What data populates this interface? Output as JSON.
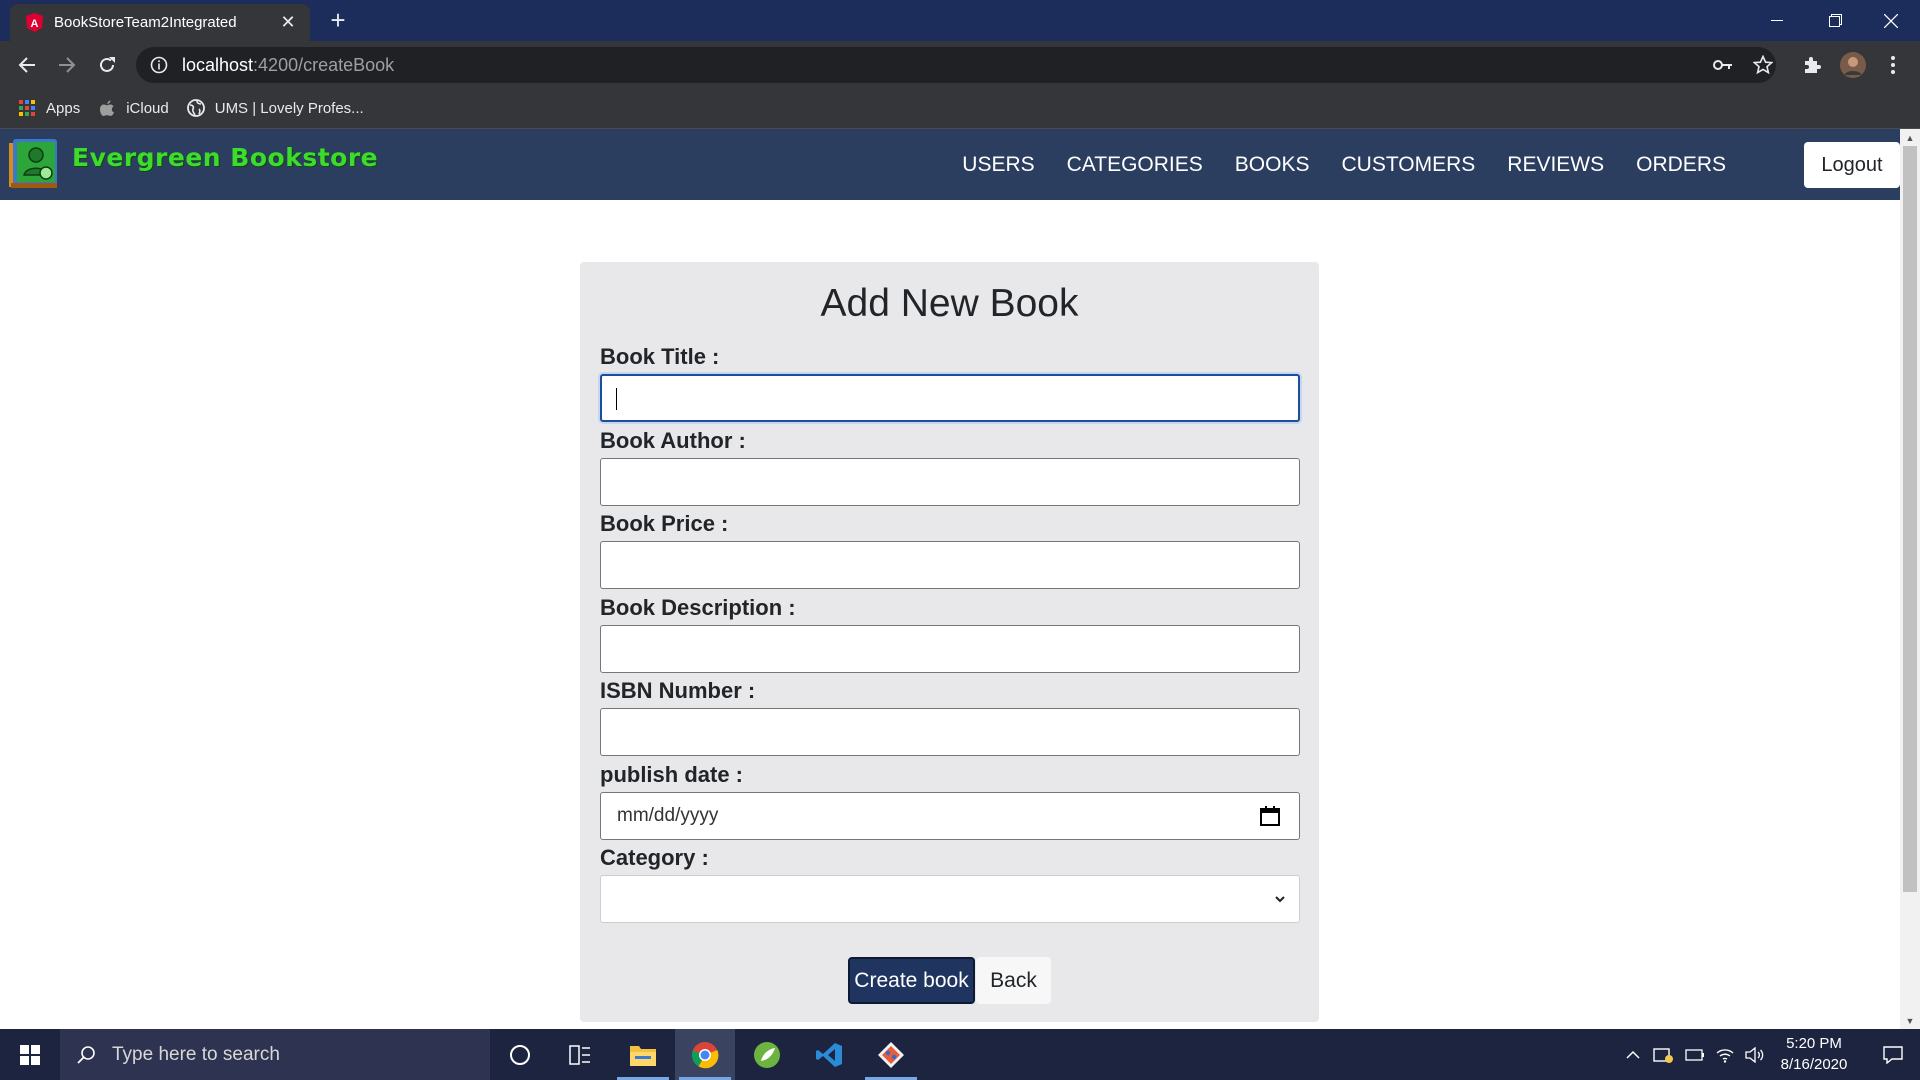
{
  "browser": {
    "tab_title": "BookStoreTeam2Integrated",
    "url_host": "localhost",
    "url_path": ":4200/createBook",
    "bookmarks": [
      {
        "label": "Apps",
        "icon": "apps-grid-icon"
      },
      {
        "label": "iCloud",
        "icon": "apple-icon"
      },
      {
        "label": "UMS | Lovely Profes...",
        "icon": "globe-icon"
      }
    ]
  },
  "app": {
    "brand": "Evergreen Bookstore",
    "nav": [
      "USERS",
      "CATEGORIES",
      "BOOKS",
      "CUSTOMERS",
      "REVIEWS",
      "ORDERS"
    ],
    "logout_label": "Logout"
  },
  "form": {
    "title": "Add New Book",
    "fields": [
      {
        "label": "Book Title :",
        "value": ""
      },
      {
        "label": "Book Author :",
        "value": ""
      },
      {
        "label": "Book Price :",
        "value": ""
      },
      {
        "label": "Book Description :",
        "value": ""
      },
      {
        "label": "ISBN Number :",
        "value": ""
      },
      {
        "label": "publish date :",
        "placeholder": "mm/dd/yyyy"
      },
      {
        "label": "Category :",
        "value": ""
      }
    ],
    "create_label": "Create book",
    "back_label": "Back"
  },
  "taskbar": {
    "search_placeholder": "Type here to search",
    "time": "5:20 PM",
    "date": "8/16/2020"
  },
  "colors": {
    "tabbar": "#1c2c5b",
    "appnav": "#2c3e5f",
    "brand_green": "#3ddc2c",
    "create_button": "#1f3560"
  }
}
